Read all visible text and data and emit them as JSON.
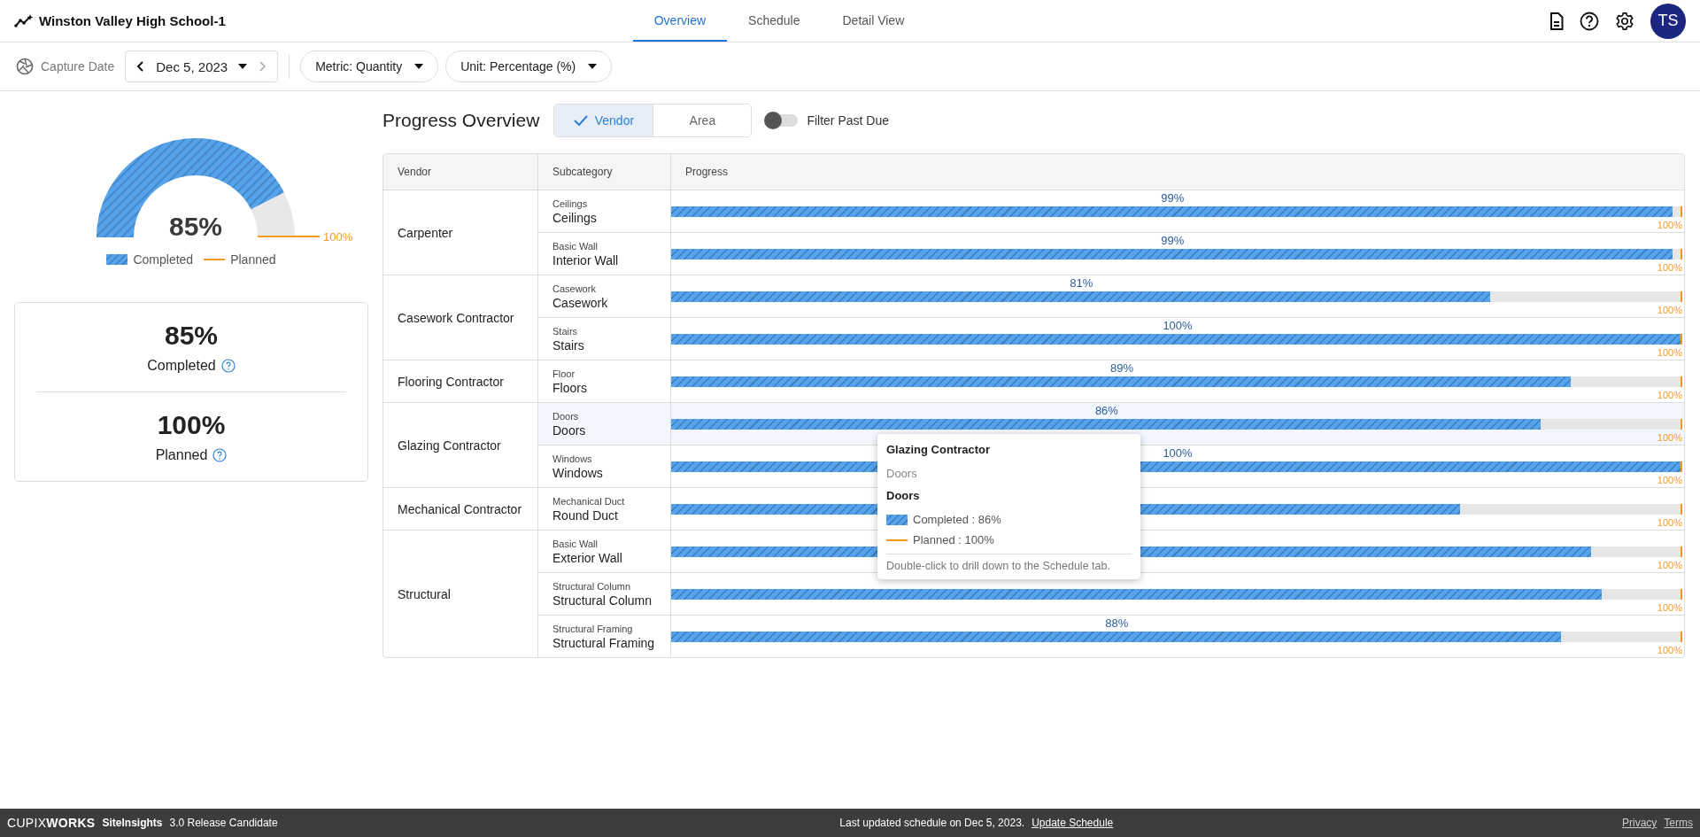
{
  "header": {
    "title": "Winston Valley High School-1",
    "tabs": [
      {
        "label": "Overview",
        "selected": true
      },
      {
        "label": "Schedule",
        "selected": false
      },
      {
        "label": "Detail View",
        "selected": false
      }
    ],
    "avatar": "TS"
  },
  "toolbar": {
    "capture_label": "Capture Date",
    "date": "Dec 5, 2023",
    "metric": "Metric: Quantity",
    "unit": "Unit: Percentage (%)"
  },
  "summary": {
    "gauge": {
      "value_text": "85%",
      "level": 0.85,
      "planned_text": "100%"
    },
    "legend": {
      "completed": "Completed",
      "planned": "Planned"
    },
    "stats": [
      {
        "value": "85%",
        "label": "Completed"
      },
      {
        "value": "100%",
        "label": "Planned"
      }
    ]
  },
  "overview": {
    "title": "Progress Overview",
    "group_by": [
      {
        "label": "Vendor",
        "selected": true
      },
      {
        "label": "Area",
        "selected": false
      }
    ],
    "filter": {
      "label": "Filter Past Due",
      "on": false
    },
    "table": {
      "columns": [
        "Vendor",
        "Subcategory",
        "Progress"
      ],
      "groups": [
        {
          "vendor": "Carpenter",
          "rows": [
            {
              "category": "Ceilings",
              "name": "Ceilings",
              "level": 0.99,
              "label": "99%",
              "planned": "100%",
              "hovered": false
            },
            {
              "category": "Basic Wall",
              "name": "Interior Wall",
              "level": 0.99,
              "label": "99%",
              "planned": "100%",
              "hovered": false
            }
          ]
        },
        {
          "vendor": "Casework Contractor",
          "rows": [
            {
              "category": "Casework",
              "name": "Casework",
              "level": 0.81,
              "label": "81%",
              "planned": "100%",
              "hovered": false
            },
            {
              "category": "Stairs",
              "name": "Stairs",
              "level": 1,
              "label": "100%",
              "planned": "100%",
              "hovered": false
            }
          ]
        },
        {
          "vendor": "Flooring Contractor",
          "rows": [
            {
              "category": "Floor",
              "name": "Floors",
              "level": 0.89,
              "label": "89%",
              "planned": "100%",
              "hovered": false
            }
          ]
        },
        {
          "vendor": "Glazing Contractor",
          "rows": [
            {
              "category": "Doors",
              "name": "Doors",
              "level": 0.86,
              "label": "86%",
              "planned": "100%",
              "hovered": true
            },
            {
              "category": "Windows",
              "name": "Windows",
              "level": 1,
              "label": "100%",
              "planned": "100%",
              "hovered": false
            }
          ]
        },
        {
          "vendor": "Mechanical Contractor",
          "rows": [
            {
              "category": "Mechanical Duct",
              "name": "Round Duct",
              "level": 0.78,
              "planned": "100%",
              "hovered": false
            }
          ]
        },
        {
          "vendor": "Structural",
          "rows": [
            {
              "category": "Basic Wall",
              "name": "Exterior Wall",
              "level": 0.91,
              "planned": "100%",
              "hovered": false
            },
            {
              "category": "Structural Column",
              "name": "Structural Column",
              "level": 0.92,
              "planned": "100%",
              "hovered": false
            },
            {
              "category": "Structural Framing",
              "name": "Structural Framing",
              "level": 0.88,
              "label": "88%",
              "planned": "100%",
              "hovered": false
            }
          ]
        }
      ]
    }
  },
  "tooltip": {
    "vendor": "Glazing Contractor",
    "category": "Doors",
    "name": "Doors",
    "completed": "Completed : 86%",
    "planned": "Planned : 100%",
    "hint": "Double-click to drill down to the Schedule tab."
  },
  "footer": {
    "logo": "CUPIX**WORKS**",
    "product": "SiteInsights",
    "version": "3.0 Release Candidate",
    "updated": "Last updated schedule on Dec 5, 2023.",
    "update_link": "Update Schedule",
    "links": [
      "Privacy",
      "Terms"
    ]
  }
}
